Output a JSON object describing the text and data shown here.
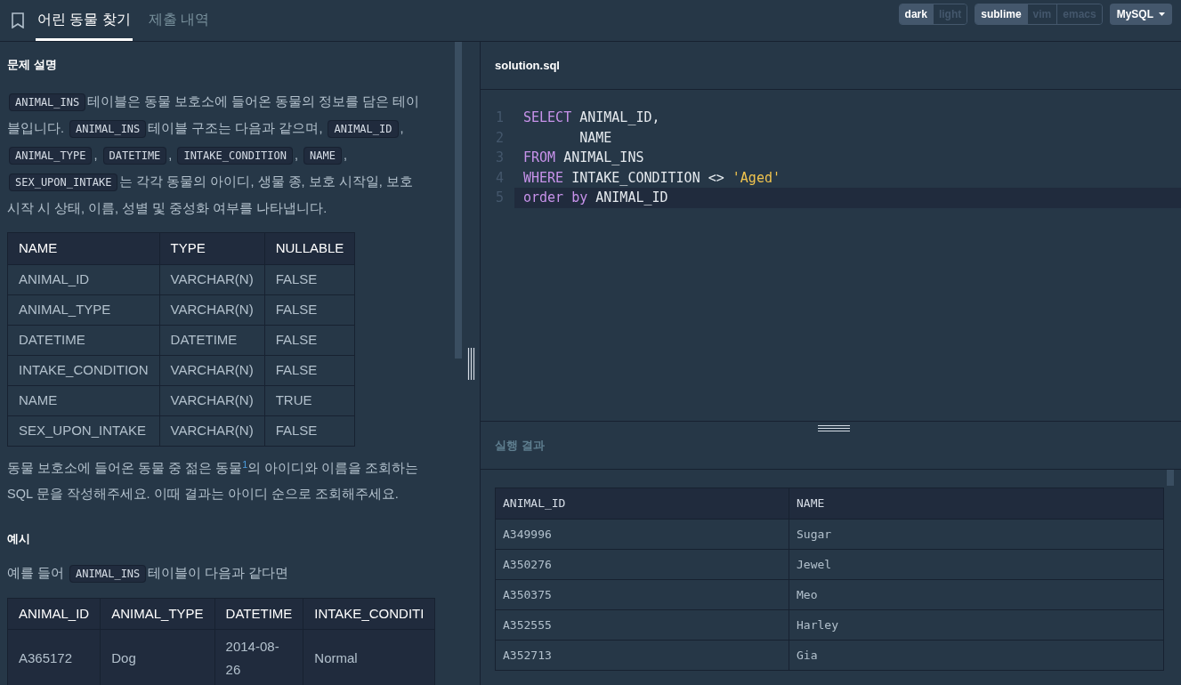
{
  "tabs": [
    {
      "label": "어린 동물 찾기",
      "selected": true
    },
    {
      "label": "제출 내역",
      "selected": false
    }
  ],
  "toolbar": {
    "themes": [
      {
        "label": "dark",
        "selected": true
      },
      {
        "label": "light",
        "selected": false
      }
    ],
    "keymaps": [
      {
        "label": "sublime",
        "selected": true
      },
      {
        "label": "vim",
        "selected": false
      },
      {
        "label": "emacs",
        "selected": false
      }
    ],
    "language": "MySQL"
  },
  "description": {
    "heading": "문제 설명",
    "intro": [
      {
        "kind": "code",
        "text": "ANIMAL_INS"
      },
      {
        "kind": "text",
        "text": "테이블은 동물 보호소에 들어온 동물의 정보를 담은 테이"
      },
      {
        "kind": "text",
        "text": "블입니다."
      },
      {
        "kind": "code",
        "text": "ANIMAL_INS"
      },
      {
        "kind": "text",
        "text": "테이블 구조는 다음과 같으며,"
      },
      {
        "kind": "code",
        "text": "ANIMAL_ID"
      },
      {
        "kind": "text",
        "text": ","
      },
      {
        "kind": "code",
        "text": "ANIMAL_TYPE"
      },
      {
        "kind": "text",
        "text": ","
      },
      {
        "kind": "code",
        "text": "DATETIME"
      },
      {
        "kind": "text",
        "text": ","
      },
      {
        "kind": "code",
        "text": "INTAKE_CONDITION"
      },
      {
        "kind": "text",
        "text": ","
      },
      {
        "kind": "code",
        "text": "NAME"
      },
      {
        "kind": "text",
        "text": ","
      },
      {
        "kind": "code",
        "text": "SEX_UPON_INTAKE"
      },
      {
        "kind": "text",
        "text": "는 각각 동물의 아이디, 생물 종, 보호 시작일, 보호"
      },
      {
        "kind": "text",
        "text": "시작 시 상태, 이름, 성별 및 중성화 여부를 나타냅니다."
      }
    ],
    "schema": {
      "columns": [
        "NAME",
        "TYPE",
        "NULLABLE"
      ],
      "rows": [
        [
          "ANIMAL_ID",
          "VARCHAR(N)",
          "FALSE"
        ],
        [
          "ANIMAL_TYPE",
          "VARCHAR(N)",
          "FALSE"
        ],
        [
          "DATETIME",
          "DATETIME",
          "FALSE"
        ],
        [
          "INTAKE_CONDITION",
          "VARCHAR(N)",
          "FALSE"
        ],
        [
          "NAME",
          "VARCHAR(N)",
          "TRUE"
        ],
        [
          "SEX_UPON_INTAKE",
          "VARCHAR(N)",
          "FALSE"
        ]
      ]
    },
    "task": "동물 보호소에 들어온 동물 중 젊은 동물$^{1}$의 아이디와 이름을 조회하는 SQL 문을 작성해주세요. 이때 결과는 아이디 순으로 조회해주세요.",
    "example_heading": "예시",
    "example_intro": [
      {
        "kind": "text",
        "text": "예를 들어"
      },
      {
        "kind": "code",
        "text": "ANIMAL_INS"
      },
      {
        "kind": "text",
        "text": "테이블이 다음과 같다면"
      }
    ],
    "example_table": {
      "columns": [
        "ANIMAL_ID",
        "ANIMAL_TYPE",
        "DATETIME",
        "INTAKE_CONDITI"
      ],
      "rows": [
        [
          "A365172",
          "Dog",
          "2014-08-26",
          "Normal"
        ]
      ]
    }
  },
  "editor": {
    "filename": "solution.sql",
    "lines": [
      [
        {
          "kind": "keyword",
          "text": "SELECT"
        },
        {
          "kind": "plain",
          "text": " ANIMAL_ID,"
        }
      ],
      [
        {
          "kind": "plain",
          "text": "       NAME"
        }
      ],
      [
        {
          "kind": "keyword",
          "text": "FROM"
        },
        {
          "kind": "plain",
          "text": " ANIMAL_INS"
        }
      ],
      [
        {
          "kind": "keyword",
          "text": "WHERE"
        },
        {
          "kind": "plain",
          "text": " INTAKE_CONDITION <> "
        },
        {
          "kind": "string",
          "text": "'Aged'"
        }
      ],
      [
        {
          "kind": "keyword",
          "text": "order by"
        },
        {
          "kind": "plain",
          "text": " ANIMAL_ID"
        }
      ]
    ],
    "line_numbers": [
      "1",
      "2",
      "3",
      "4",
      "5"
    ]
  },
  "results": {
    "title": "실행 결과",
    "columns": [
      "ANIMAL_ID",
      "NAME"
    ],
    "rows": [
      [
        "A349996",
        "Sugar"
      ],
      [
        "A350276",
        "Jewel"
      ],
      [
        "A350375",
        "Meo"
      ],
      [
        "A352555",
        "Harley"
      ],
      [
        "A352713",
        "Gia"
      ]
    ]
  }
}
